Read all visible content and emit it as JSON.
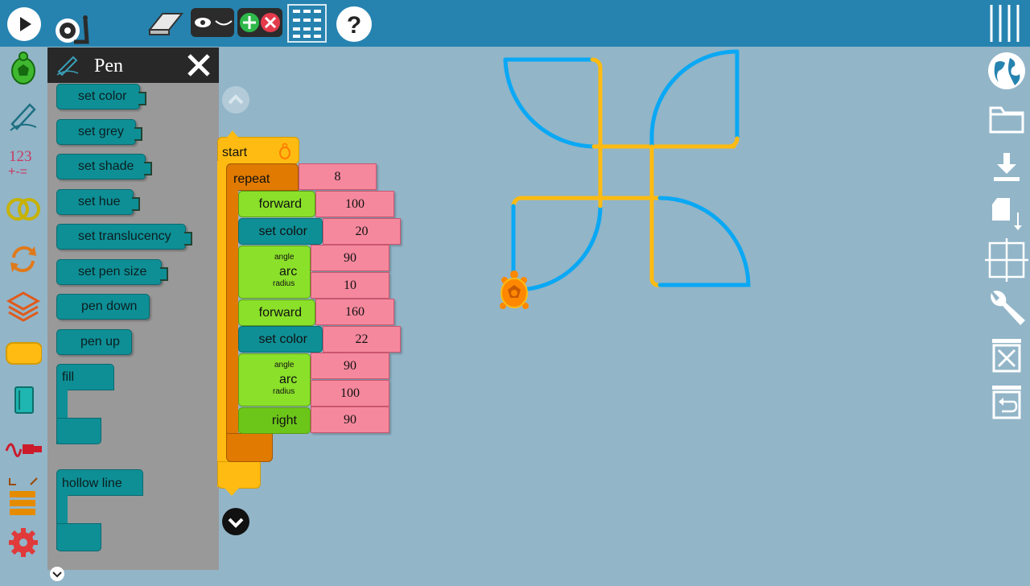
{
  "palette": {
    "title": "Pen",
    "blocks": [
      "set color",
      "set grey",
      "set shade",
      "set hue",
      "set translucency",
      "set pen size",
      "pen down",
      "pen up",
      "fill",
      "hollow line"
    ]
  },
  "program": {
    "start_label": "start",
    "repeat_label": "repeat",
    "repeat_count": "8",
    "statements": [
      {
        "label": "forward",
        "value": "100"
      },
      {
        "label": "set color",
        "value": "20"
      },
      {
        "label": "arc",
        "angle_label": "angle",
        "angle": "90",
        "radius_label": "radius",
        "radius": "10"
      },
      {
        "label": "forward",
        "value": "160"
      },
      {
        "label": "set color",
        "value": "22"
      },
      {
        "label": "arc",
        "angle_label": "angle",
        "angle": "90",
        "radius_label": "radius",
        "radius": "100"
      },
      {
        "label": "right",
        "value": "90"
      }
    ]
  },
  "colors": {
    "toolbar": "#2683b0",
    "canvas": "#92b5c8",
    "yellow": "#ffbb11",
    "blue": "#0aa8f4",
    "turtle": "#ff8800"
  },
  "icons": {
    "toolbar": [
      "play-icon",
      "slow-run-snail-icon",
      "eraser-icon",
      "hide-show-blocks-icon",
      "collapse-expand-icon",
      "grid-icon",
      "help-icon",
      "main-menu-icon"
    ],
    "palettes": [
      "turtle-palette-icon",
      "pen-palette-icon",
      "number-palette-icon",
      "boolean-palette-icon",
      "flow-palette-icon",
      "action-palette-icon",
      "boxes-palette-icon",
      "media-palette-icon",
      "sensors-palette-icon",
      "heap-palette-icon",
      "extras-palette-icon"
    ],
    "right": [
      "language-icon",
      "open-folder-icon",
      "save-icon",
      "load-plugin-icon",
      "coordinate-grid-icon",
      "tools-wrench-icon",
      "delete-trash-icon",
      "restore-trash-icon"
    ]
  }
}
